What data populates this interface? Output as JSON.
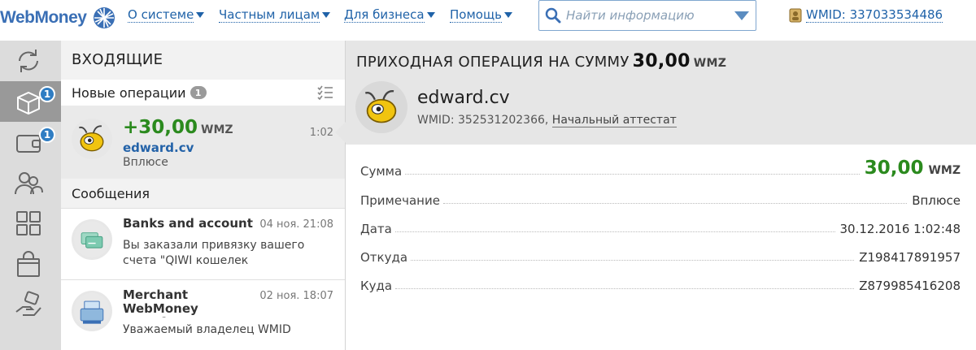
{
  "header": {
    "logo_text": "WebMoney",
    "nav": [
      {
        "label": "О системе"
      },
      {
        "label": "Частным лицам"
      },
      {
        "label": "Для бизнеса"
      },
      {
        "label": "Помощь"
      }
    ],
    "search_placeholder": "Найти информацию",
    "wmid_label": "WMID: 337033534486"
  },
  "rail": {
    "items": [
      {
        "name": "refresh"
      },
      {
        "name": "operations",
        "badge": "1",
        "active": true
      },
      {
        "name": "wallet",
        "badge": "1"
      },
      {
        "name": "contacts"
      },
      {
        "name": "services"
      },
      {
        "name": "shop"
      },
      {
        "name": "credit"
      }
    ]
  },
  "inbox": {
    "title": "ВХОДЯЩИЕ",
    "new_ops_label": "Новые операции",
    "new_ops_count": "1",
    "operation": {
      "amount": "+30,00",
      "currency": "WMZ",
      "time": "1:02",
      "name": "edward.cv",
      "note": "Вплюсе"
    },
    "messages_label": "Сообщения",
    "messages": [
      {
        "title": "Banks and account",
        "date": "04 ноя. 21:08",
        "body": "Вы заказали привязку вашего счета \"QIWI кошелек"
      },
      {
        "title": "Merchant WebMoney Transfer",
        "date": "02 ноя. 18:07",
        "body": "Уважаемый владелец WMID"
      }
    ]
  },
  "detail": {
    "title": "ПРИХОДНАЯ ОПЕРАЦИЯ НА СУММУ",
    "amount": "30,00",
    "currency": "WMZ",
    "name": "edward.cv",
    "wmid": "WMID: 352531202366,",
    "attestat": "Начальный аттестат",
    "rows": [
      {
        "key": "Сумма",
        "value": "30,00",
        "currency": "WMZ"
      },
      {
        "key": "Примечание",
        "value": "Вплюсе"
      },
      {
        "key": "Дата",
        "value": "30.12.2016 1:02:48"
      },
      {
        "key": "Откуда",
        "value": "Z198417891957"
      },
      {
        "key": "Куда",
        "value": "Z879985416208"
      }
    ]
  },
  "colors": {
    "accent": "#1f62a8",
    "positive": "#2b8a1e",
    "badge": "#2f7dc3"
  }
}
